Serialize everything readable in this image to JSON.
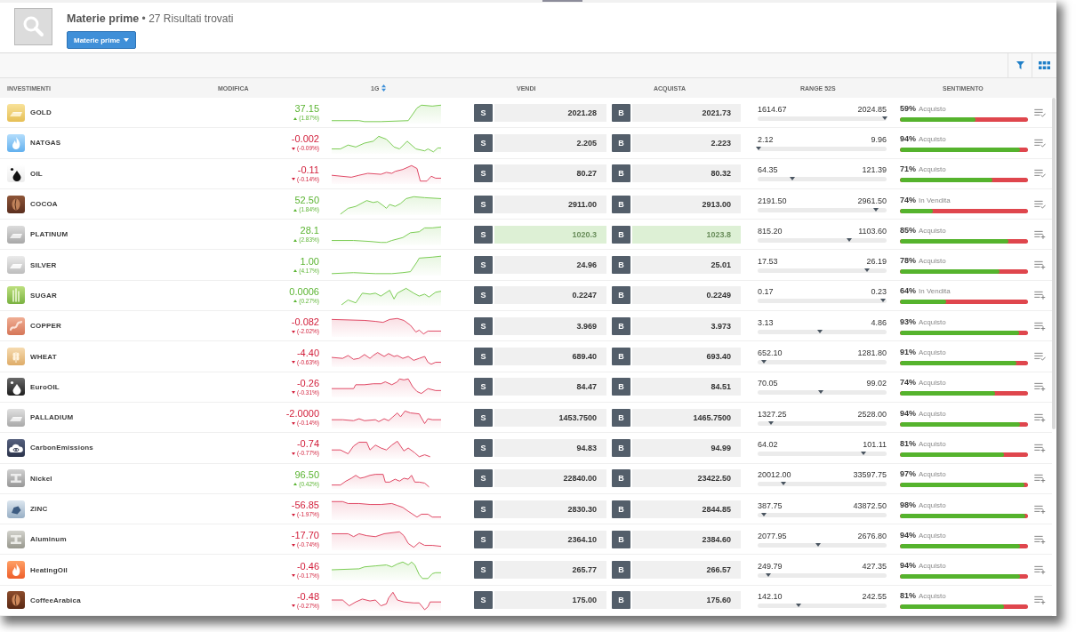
{
  "header": {
    "title": "**Materie prime** • 27 Risultati trovati",
    "category_button": {
      "label": "Materie prime"
    }
  },
  "table": {
    "columns": [
      {
        "label": "INVESTIMENTI",
        "sortable": false
      },
      {
        "label": "MODIFICA",
        "sortable": false
      },
      {
        "label": "1G",
        "sortable": true
      },
      {
        "label": "VENDI",
        "sortable": false
      },
      {
        "label": "ACQUISTA",
        "sortable": false
      },
      {
        "label": "RANGE 52S",
        "sortable": false
      },
      {
        "label": "SENTIMENTO",
        "sortable": false
      }
    ],
    "rows": [
      {
        "name": "GOLD",
        "change": {
          "value": "37.15",
          "percent": "(1.87%)",
          "up": true
        },
        "trend_up": true,
        "sell_label": "S",
        "sell": "2021.28",
        "buy_label": "B",
        "buy": "2021.73",
        "highlighted": false,
        "range": {
          "low": "1614.67",
          "high": "2024.85",
          "level": 0.985
        },
        "sentiment": {
          "percent": "59%",
          "label": "Acquisto",
          "level": 0.59
        },
        "watchlisted": true
      },
      {
        "name": "NATGAS",
        "change": {
          "value": "-0.002",
          "percent": "(-0.09%)",
          "up": false
        },
        "trend_up": true,
        "sell_label": "S",
        "sell": "2.205",
        "buy_label": "B",
        "buy": "2.223",
        "highlighted": false,
        "range": {
          "low": "2.12",
          "high": "9.96",
          "level": 0.01
        },
        "sentiment": {
          "percent": "94%",
          "label": "Acquisto",
          "level": 0.94
        },
        "watchlisted": true
      },
      {
        "name": "OIL",
        "change": {
          "value": "-0.11",
          "percent": "(-0.14%)",
          "up": false
        },
        "trend_up": false,
        "sell_label": "S",
        "sell": "80.27",
        "buy_label": "B",
        "buy": "80.32",
        "highlighted": false,
        "range": {
          "low": "64.35",
          "high": "121.39",
          "level": 0.27
        },
        "sentiment": {
          "percent": "71%",
          "label": "Acquisto",
          "level": 0.72
        },
        "watchlisted": true
      },
      {
        "name": "COCOA",
        "change": {
          "value": "52.50",
          "percent": "(1.84%)",
          "up": true
        },
        "trend_up": true,
        "sell_label": "S",
        "sell": "2911.00",
        "buy_label": "B",
        "buy": "2913.00",
        "highlighted": false,
        "range": {
          "low": "2191.50",
          "high": "2961.50",
          "level": 0.92
        },
        "sentiment": {
          "percent": "74%",
          "label": "In Vendita",
          "level": 0.26
        },
        "watchlisted": true
      },
      {
        "name": "PLATINUM",
        "change": {
          "value": "28.1",
          "percent": "(2.83%)",
          "up": true
        },
        "trend_up": true,
        "sell_label": "S",
        "sell": "1020.3",
        "buy_label": "B",
        "buy": "1023.8",
        "highlighted": true,
        "range": {
          "low": "815.20",
          "high": "1103.60",
          "level": 0.71
        },
        "sentiment": {
          "percent": "85%",
          "label": "Acquisto",
          "level": 0.85
        },
        "watchlisted": false
      },
      {
        "name": "SILVER",
        "change": {
          "value": "1.00",
          "percent": "(4.17%)",
          "up": true
        },
        "trend_up": true,
        "sell_label": "S",
        "sell": "24.96",
        "buy_label": "B",
        "buy": "25.01",
        "highlighted": false,
        "range": {
          "low": "17.53",
          "high": "26.19",
          "level": 0.85
        },
        "sentiment": {
          "percent": "78%",
          "label": "Acquisto",
          "level": 0.78
        },
        "watchlisted": false
      },
      {
        "name": "SUGAR",
        "change": {
          "value": "0.0006",
          "percent": "(0.27%)",
          "up": true
        },
        "trend_up": true,
        "sell_label": "S",
        "sell": "0.2247",
        "buy_label": "B",
        "buy": "0.2249",
        "highlighted": false,
        "range": {
          "low": "0.17",
          "high": "0.23",
          "level": 0.97
        },
        "sentiment": {
          "percent": "64%",
          "label": "In Vendita",
          "level": 0.36
        },
        "watchlisted": false
      },
      {
        "name": "COPPER",
        "change": {
          "value": "-0.082",
          "percent": "(-2.02%)",
          "up": false
        },
        "trend_up": false,
        "sell_label": "S",
        "sell": "3.969",
        "buy_label": "B",
        "buy": "3.973",
        "highlighted": false,
        "range": {
          "low": "3.13",
          "high": "4.86",
          "level": 0.48
        },
        "sentiment": {
          "percent": "93%",
          "label": "Acquisto",
          "level": 0.93
        },
        "watchlisted": false
      },
      {
        "name": "WHEAT",
        "change": {
          "value": "-4.40",
          "percent": "(-0.63%)",
          "up": false
        },
        "trend_up": false,
        "sell_label": "S",
        "sell": "689.40",
        "buy_label": "B",
        "buy": "693.40",
        "highlighted": false,
        "range": {
          "low": "652.10",
          "high": "1281.80",
          "level": 0.05
        },
        "sentiment": {
          "percent": "91%",
          "label": "Acquisto",
          "level": 0.91
        },
        "watchlisted": true
      },
      {
        "name": "EuroOIL",
        "change": {
          "value": "-0.26",
          "percent": "(-0.31%)",
          "up": false
        },
        "trend_up": false,
        "sell_label": "S",
        "sell": "84.47",
        "buy_label": "B",
        "buy": "84.51",
        "highlighted": false,
        "range": {
          "low": "70.05",
          "high": "99.02",
          "level": 0.49
        },
        "sentiment": {
          "percent": "74%",
          "label": "Acquisto",
          "level": 0.74
        },
        "watchlisted": false
      },
      {
        "name": "PALLADIUM",
        "change": {
          "value": "-2.0000",
          "percent": "(-0.14%)",
          "up": false
        },
        "trend_up": false,
        "sell_label": "S",
        "sell": "1453.7500",
        "buy_label": "B",
        "buy": "1465.7500",
        "highlighted": false,
        "range": {
          "low": "1327.25",
          "high": "2528.00",
          "level": 0.1
        },
        "sentiment": {
          "percent": "94%",
          "label": "Acquisto",
          "level": 0.94
        },
        "watchlisted": false
      },
      {
        "name": "CarbonEmissions",
        "change": {
          "value": "-0.74",
          "percent": "(-0.77%)",
          "up": false
        },
        "trend_up": false,
        "sell_label": "S",
        "sell": "94.83",
        "buy_label": "B",
        "buy": "94.99",
        "highlighted": false,
        "range": {
          "low": "64.02",
          "high": "101.11",
          "level": 0.82
        },
        "sentiment": {
          "percent": "81%",
          "label": "Acquisto",
          "level": 0.81
        },
        "watchlisted": false
      },
      {
        "name": "Nickel",
        "change": {
          "value": "96.50",
          "percent": "(0.42%)",
          "up": true
        },
        "trend_up": false,
        "sell_label": "S",
        "sell": "22840.00",
        "buy_label": "B",
        "buy": "23422.50",
        "highlighted": false,
        "range": {
          "low": "20012.00",
          "high": "33597.75",
          "level": 0.2
        },
        "sentiment": {
          "percent": "97%",
          "label": "Acquisto",
          "level": 0.97
        },
        "watchlisted": false
      },
      {
        "name": "ZINC",
        "change": {
          "value": "-56.85",
          "percent": "(-1.97%)",
          "up": false
        },
        "trend_up": false,
        "sell_label": "S",
        "sell": "2830.30",
        "buy_label": "B",
        "buy": "2844.85",
        "highlighted": false,
        "range": {
          "low": "387.75",
          "high": "43872.50",
          "level": 0.05
        },
        "sentiment": {
          "percent": "98%",
          "label": "Acquisto",
          "level": 0.98
        },
        "watchlisted": false
      },
      {
        "name": "Aluminum",
        "change": {
          "value": "-17.70",
          "percent": "(-0.74%)",
          "up": false
        },
        "trend_up": false,
        "sell_label": "S",
        "sell": "2364.10",
        "buy_label": "B",
        "buy": "2384.60",
        "highlighted": false,
        "range": {
          "low": "2077.95",
          "high": "2676.80",
          "level": 0.47
        },
        "sentiment": {
          "percent": "94%",
          "label": "Acquisto",
          "level": 0.94
        },
        "watchlisted": false
      },
      {
        "name": "HeatingOil",
        "change": {
          "value": "-0.46",
          "percent": "(-0.17%)",
          "up": false
        },
        "trend_up": true,
        "sell_label": "S",
        "sell": "265.77",
        "buy_label": "B",
        "buy": "266.57",
        "highlighted": false,
        "range": {
          "low": "249.79",
          "high": "427.35",
          "level": 0.085
        },
        "sentiment": {
          "percent": "94%",
          "label": "Acquisto",
          "level": 0.94
        },
        "watchlisted": false
      },
      {
        "name": "CoffeeArabica",
        "change": {
          "value": "-0.48",
          "percent": "(-0.27%)",
          "up": false
        },
        "trend_up": false,
        "sell_label": "S",
        "sell": "175.00",
        "buy_label": "B",
        "buy": "175.60",
        "highlighted": false,
        "range": {
          "low": "142.10",
          "high": "242.55",
          "level": 0.32
        },
        "sentiment": {
          "percent": "81%",
          "label": "Acquisto",
          "level": 0.81
        },
        "watchlisted": false
      }
    ]
  }
}
